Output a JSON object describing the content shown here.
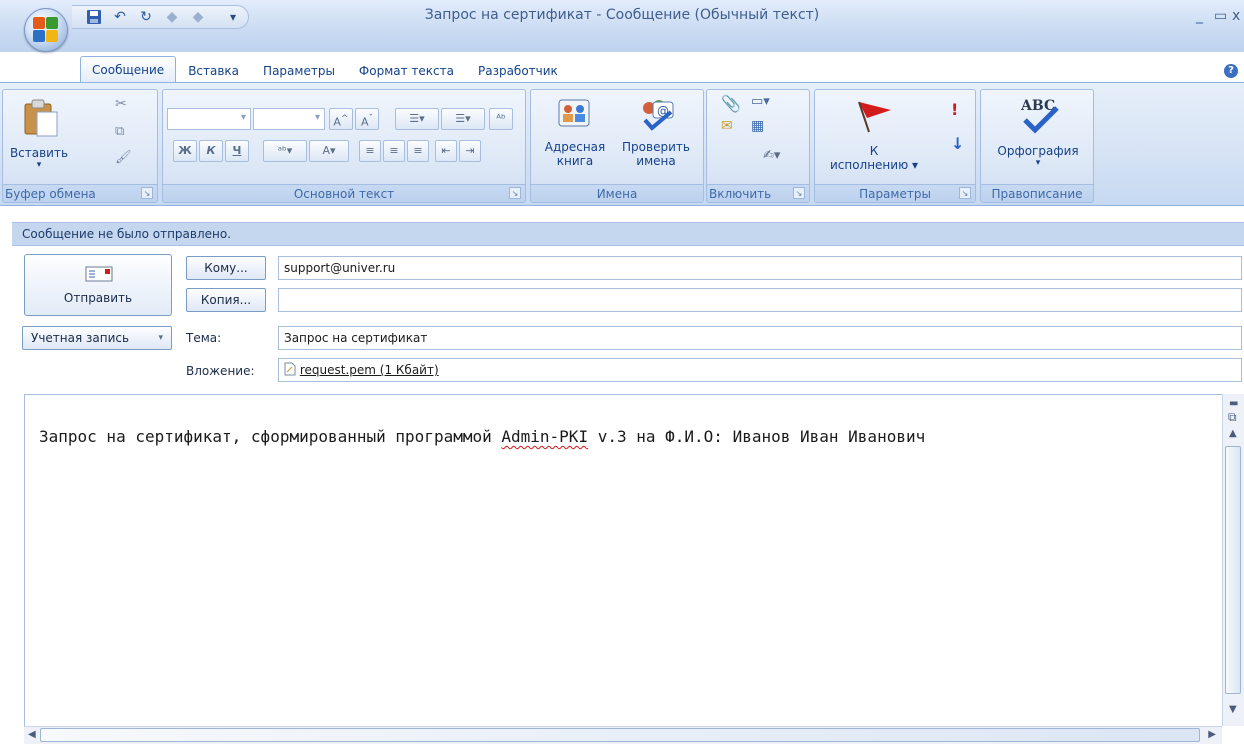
{
  "window": {
    "title": "Запрос на сертификат - Сообщение (Обычный текст)"
  },
  "tabs": [
    "Сообщение",
    "Вставка",
    "Параметры",
    "Формат текста",
    "Разработчик"
  ],
  "ribbon": {
    "clipboard": {
      "paste_label": "Вставить",
      "group_label": "Буфер обмена"
    },
    "basic_text": {
      "group_label": "Основной текст"
    },
    "names": {
      "address_book_label_1": "Адресная",
      "address_book_label_2": "книга",
      "check_names_label_1": "Проверить",
      "check_names_label_2": "имена",
      "group_label": "Имена"
    },
    "include": {
      "group_label": "Включить"
    },
    "options": {
      "follow_up_label_1": "К",
      "follow_up_label_2": "исполнению",
      "group_label": "Параметры"
    },
    "proofing": {
      "spelling_label": "Орфография",
      "group_label": "Правописание"
    }
  },
  "infobar": {
    "text": "Сообщение не было отправлено."
  },
  "header": {
    "send_label": "Отправить",
    "to_label": "Кому...",
    "to_value": "support@univer.ru",
    "cc_label": "Копия...",
    "cc_value": "",
    "account_label": "Учетная запись",
    "subject_label": "Тема:",
    "subject_value": "Запрос на сертификат",
    "attachment_label": "Вложение:",
    "attachment_value": "request.pem (1 Кбайт)"
  },
  "body": {
    "text_before": "Запрос на сертификат, сформированный программой ",
    "misspelled": "Admin-PKI",
    "text_after": " v.3 на Ф.И.О: Иванов Иван Иванович"
  }
}
